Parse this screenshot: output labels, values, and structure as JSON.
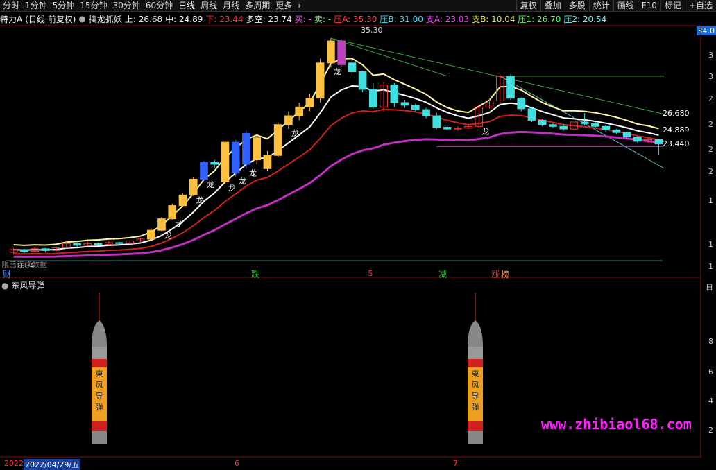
{
  "toolbar": {
    "periods": [
      "分时",
      "1分钟",
      "5分钟",
      "15分钟",
      "30分钟",
      "60分钟",
      "日线",
      "周线",
      "月线",
      "多周期",
      "更多"
    ],
    "active": "日线",
    "right": [
      "复权",
      "叠加",
      "多股",
      "统计",
      "画线",
      "F10",
      "标记",
      "+自选"
    ]
  },
  "infobar": {
    "stock": "特力A",
    "mode": "(日线 前复权)",
    "indicator": "擒龙抓妖",
    "upper": "上: 26.68",
    "mid": "中: 24.89",
    "lower": "下: 23.44",
    "duokong": "多空: 23.74",
    "buy": "买: -",
    "sell": "卖: -",
    "pa": "压A: 35.30",
    "pb": "压B: 31.00",
    "za": "支A: 23.03",
    "zb": "支B: 10.04",
    "p1": "压1: 26.70",
    "p2": "压2: 20.54"
  },
  "price_tag": "34.0",
  "labels": {
    "high": "35.30",
    "low": "10.04",
    "v1": "26.680",
    "v2": "24.889",
    "v3": "23.440",
    "low_note": "限三连续数据"
  },
  "markers": [
    "财",
    "跌",
    "$",
    "减",
    "涨",
    "榜"
  ],
  "lower_title": "东风导弹",
  "missile_text": [
    "東",
    "风",
    "导",
    "弹"
  ],
  "watermark": "www.zhibiaol68.com",
  "dates": {
    "d1": "2022",
    "d2": "2022/04/29/五",
    "m6": "6",
    "m7": "7"
  },
  "right_axis": [
    "3",
    "3",
    "2",
    "2",
    "2",
    "2",
    "1",
    "1",
    "1",
    "日"
  ],
  "lower_axis": [
    "8",
    "6",
    "4",
    "2"
  ],
  "candle_markers": "龙",
  "chart_data": {
    "type": "candlestick",
    "title": "擒龙抓妖",
    "candles": [
      {
        "o": 11.0,
        "c": 11.3,
        "h": 11.5,
        "l": 10.8
      },
      {
        "o": 11.3,
        "c": 11.1,
        "h": 11.4,
        "l": 10.9
      },
      {
        "o": 11.1,
        "c": 11.4,
        "h": 11.6,
        "l": 11.0
      },
      {
        "o": 11.4,
        "c": 11.2,
        "h": 11.5,
        "l": 11.0
      },
      {
        "o": 11.2,
        "c": 11.5,
        "h": 11.7,
        "l": 11.1
      },
      {
        "o": 11.5,
        "c": 12.0,
        "h": 12.2,
        "l": 11.4
      },
      {
        "o": 12.0,
        "c": 11.8,
        "h": 12.1,
        "l": 11.6
      },
      {
        "o": 11.8,
        "c": 12.0,
        "h": 12.2,
        "l": 11.7
      },
      {
        "o": 12.0,
        "c": 11.9,
        "h": 12.1,
        "l": 11.8
      },
      {
        "o": 11.9,
        "c": 12.1,
        "h": 12.3,
        "l": 11.8
      },
      {
        "o": 12.1,
        "c": 12.0,
        "h": 12.2,
        "l": 11.9
      },
      {
        "o": 12.0,
        "c": 12.3,
        "h": 12.4,
        "l": 11.9
      },
      {
        "o": 12.3,
        "c": 12.5,
        "h": 12.6,
        "l": 12.1
      },
      {
        "o": 12.5,
        "c": 13.5,
        "h": 13.7,
        "l": 12.4
      },
      {
        "o": 13.5,
        "c": 14.8,
        "h": 15.0,
        "l": 13.4
      },
      {
        "o": 14.8,
        "c": 16.3,
        "h": 16.5,
        "l": 14.7
      },
      {
        "o": 16.3,
        "c": 17.5,
        "h": 17.7,
        "l": 16.2
      },
      {
        "o": 17.5,
        "c": 19.3,
        "h": 19.5,
        "l": 17.4
      },
      {
        "o": 19.3,
        "c": 21.2,
        "h": 21.4,
        "l": 19.2
      },
      {
        "o": 21.2,
        "c": 21.0,
        "h": 21.5,
        "l": 20.6
      },
      {
        "o": 19.0,
        "c": 23.5,
        "h": 23.7,
        "l": 18.8
      },
      {
        "o": 20.0,
        "c": 23.5,
        "h": 23.8,
        "l": 19.6
      },
      {
        "o": 21.0,
        "c": 24.5,
        "h": 24.8,
        "l": 20.5
      },
      {
        "o": 21.5,
        "c": 24.0,
        "h": 24.2,
        "l": 21.0
      },
      {
        "o": 20.5,
        "c": 22.0,
        "h": 22.5,
        "l": 20.2
      },
      {
        "o": 22.0,
        "c": 25.5,
        "h": 25.8,
        "l": 21.8
      },
      {
        "o": 25.5,
        "c": 26.5,
        "h": 27.0,
        "l": 25.0
      },
      {
        "o": 26.5,
        "c": 27.5,
        "h": 28.0,
        "l": 26.0
      },
      {
        "o": 27.5,
        "c": 28.5,
        "h": 29.0,
        "l": 27.0
      },
      {
        "o": 28.5,
        "c": 32.5,
        "h": 33.0,
        "l": 28.0
      },
      {
        "o": 32.5,
        "c": 35.0,
        "h": 35.3,
        "l": 32.0
      },
      {
        "o": 35.0,
        "c": 32.3,
        "h": 35.2,
        "l": 32.0
      },
      {
        "o": 32.5,
        "c": 31.5,
        "h": 32.8,
        "l": 31.0
      },
      {
        "o": 31.5,
        "c": 29.5,
        "h": 31.6,
        "l": 29.2
      },
      {
        "o": 29.5,
        "c": 27.5,
        "h": 30.2,
        "l": 27.3
      },
      {
        "o": 27.5,
        "c": 30.0,
        "h": 30.3,
        "l": 27.0
      },
      {
        "o": 30.0,
        "c": 28.0,
        "h": 30.2,
        "l": 27.5
      },
      {
        "o": 28.0,
        "c": 27.7,
        "h": 28.3,
        "l": 27.4
      },
      {
        "o": 27.7,
        "c": 27.2,
        "h": 27.9,
        "l": 26.9
      },
      {
        "o": 27.2,
        "c": 26.5,
        "h": 27.4,
        "l": 26.2
      },
      {
        "o": 26.5,
        "c": 25.2,
        "h": 26.8,
        "l": 25.0
      },
      {
        "o": 25.2,
        "c": 25.0,
        "h": 25.4,
        "l": 24.9
      },
      {
        "o": 25.0,
        "c": 25.1,
        "h": 25.3,
        "l": 24.8
      },
      {
        "o": 25.1,
        "c": 25.3,
        "h": 25.5,
        "l": 25.0
      },
      {
        "o": 25.3,
        "c": 27.5,
        "h": 27.7,
        "l": 25.2
      },
      {
        "o": 27.5,
        "c": 28.2,
        "h": 28.5,
        "l": 27.3
      },
      {
        "o": 28.2,
        "c": 31.0,
        "h": 31.2,
        "l": 28.0
      },
      {
        "o": 31.0,
        "c": 28.5,
        "h": 31.2,
        "l": 28.3
      },
      {
        "o": 28.5,
        "c": 27.3,
        "h": 28.6,
        "l": 27.0
      },
      {
        "o": 27.3,
        "c": 26.0,
        "h": 27.5,
        "l": 25.8
      },
      {
        "o": 26.0,
        "c": 25.5,
        "h": 26.2,
        "l": 25.3
      },
      {
        "o": 25.5,
        "c": 25.3,
        "h": 25.7,
        "l": 25.1
      },
      {
        "o": 25.3,
        "c": 25.0,
        "h": 25.6,
        "l": 24.8
      },
      {
        "o": 25.0,
        "c": 25.8,
        "h": 26.0,
        "l": 24.9
      },
      {
        "o": 25.8,
        "c": 25.6,
        "h": 26.8,
        "l": 25.4
      },
      {
        "o": 25.6,
        "c": 25.3,
        "h": 25.8,
        "l": 25.1
      },
      {
        "o": 25.3,
        "c": 24.9,
        "h": 25.4,
        "l": 24.7
      },
      {
        "o": 24.9,
        "c": 24.6,
        "h": 25.0,
        "l": 24.4
      },
      {
        "o": 24.6,
        "c": 24.1,
        "h": 24.7,
        "l": 23.9
      },
      {
        "o": 24.1,
        "c": 23.6,
        "h": 24.2,
        "l": 23.4
      },
      {
        "o": 23.6,
        "c": 23.8,
        "h": 24.0,
        "l": 23.4
      },
      {
        "o": 23.8,
        "c": 23.3,
        "h": 23.9,
        "l": 22.0
      }
    ],
    "missiles_at": [
      9,
      46
    ]
  }
}
